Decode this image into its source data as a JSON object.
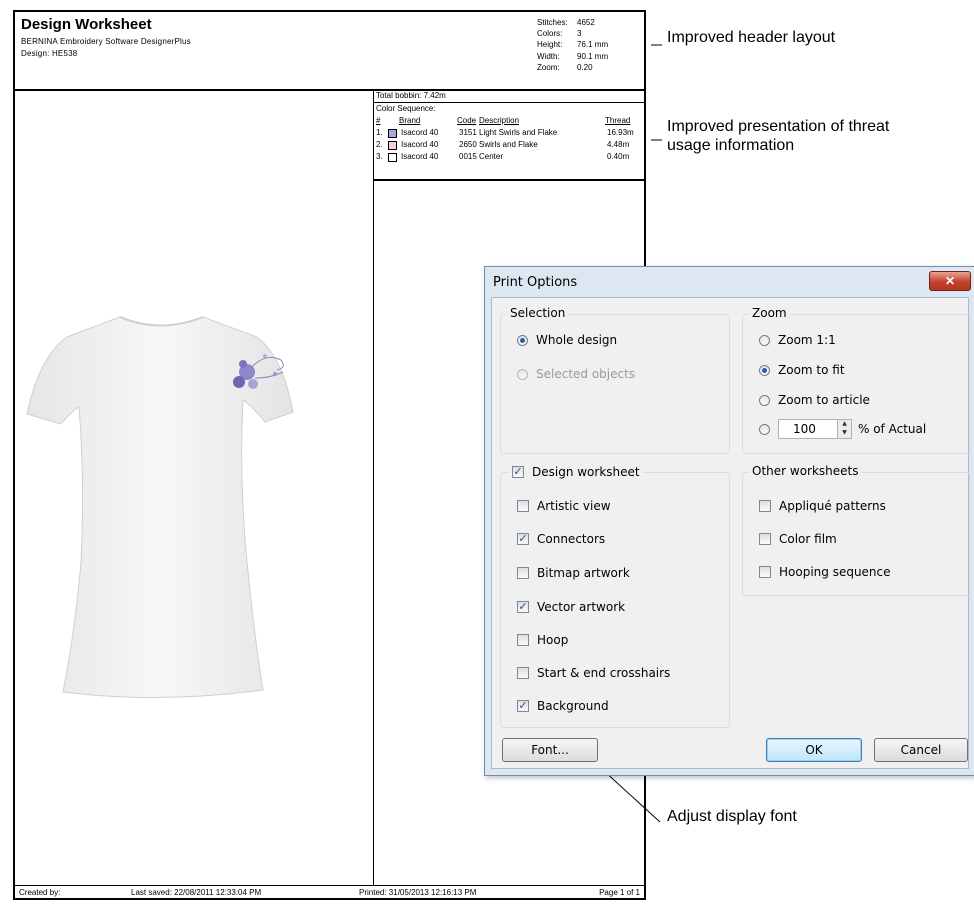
{
  "worksheet": {
    "title": "Design Worksheet",
    "software": "BERNINA Embroidery Software DesignerPlus",
    "design": "Design: HE538",
    "stats": [
      {
        "label": "Stitches:",
        "value": "4652"
      },
      {
        "label": "Colors:",
        "value": "3"
      },
      {
        "label": "Height:",
        "value": "76.1 mm"
      },
      {
        "label": "Width:",
        "value": "90.1 mm"
      },
      {
        "label": "Zoom:",
        "value": "0.20"
      }
    ],
    "total_bobbin": "Total bobbin: 7.42m",
    "color_sequence_title": "Color Sequence:",
    "seq_headers": {
      "num": "#",
      "brand": "Brand",
      "code": "Code",
      "description": "Description",
      "thread": "Thread"
    },
    "colors": [
      {
        "num": "1.",
        "swatch": "#a9a6de",
        "brand": "Isacord 40",
        "code": "3151",
        "description": "Light Swirls and Flake",
        "thread": "16.93m"
      },
      {
        "num": "2.",
        "swatch": "#f5cde6",
        "brand": "Isacord 40",
        "code": "2650",
        "description": "Swirls and Flake",
        "thread": "4.48m"
      },
      {
        "num": "3.",
        "swatch": "#ffffff",
        "brand": "Isacord 40",
        "code": "0015",
        "description": "Center",
        "thread": "0.40m"
      }
    ],
    "footer": {
      "created": "Created by:",
      "saved": "Last saved: 22/08/2011 12:33:04 PM",
      "printed": "Printed: 31/05/2013 12:16:13 PM",
      "page": "Page 1 of 1"
    }
  },
  "callouts": {
    "header": "Improved header layout",
    "thread": "Improved presentation of threat usage information",
    "font": "Adjust display font"
  },
  "dialog": {
    "title": "Print Options",
    "close_icon": "close-icon",
    "selection": {
      "title": "Selection",
      "options": [
        {
          "label": "Whole design",
          "checked": true,
          "enabled": true
        },
        {
          "label": "Selected objects",
          "checked": false,
          "enabled": false
        }
      ]
    },
    "zoom": {
      "title": "Zoom",
      "options": [
        {
          "label": "Zoom 1:1",
          "checked": false
        },
        {
          "label": "Zoom to fit",
          "checked": true
        },
        {
          "label": "Zoom to article",
          "checked": false
        }
      ],
      "custom_value": "100",
      "custom_suffix": "% of Actual"
    },
    "design_worksheet": {
      "title": "Design worksheet",
      "checked": true,
      "items": [
        {
          "label": "Artistic view",
          "checked": false
        },
        {
          "label": "Connectors",
          "checked": true
        },
        {
          "label": "Bitmap artwork",
          "checked": false
        },
        {
          "label": "Vector artwork",
          "checked": true
        },
        {
          "label": "Hoop",
          "checked": false
        },
        {
          "label": "Start & end crosshairs",
          "checked": false
        },
        {
          "label": "Background",
          "checked": true
        }
      ]
    },
    "other_worksheets": {
      "title": "Other worksheets",
      "items": [
        {
          "label": "Appliqué patterns",
          "checked": false
        },
        {
          "label": "Color film",
          "checked": false
        },
        {
          "label": "Hooping sequence",
          "checked": false
        }
      ]
    },
    "buttons": {
      "font": "Font...",
      "ok": "OK",
      "cancel": "Cancel"
    }
  }
}
